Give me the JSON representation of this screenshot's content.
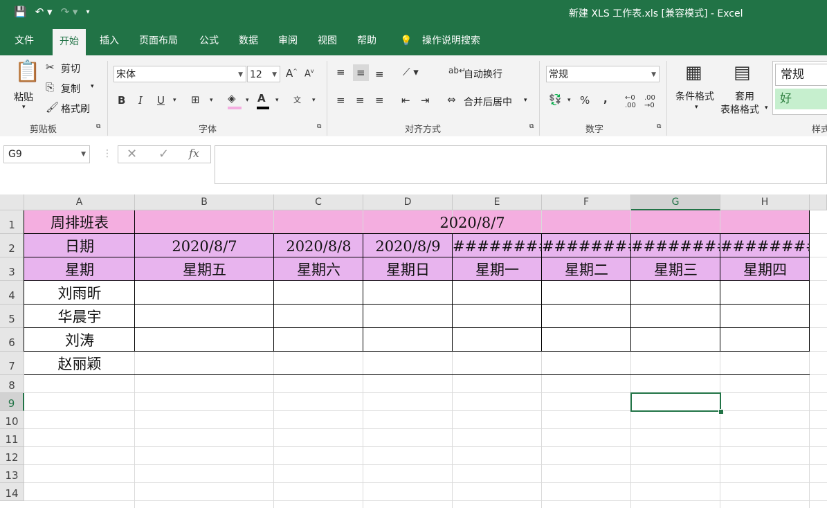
{
  "title": "新建 XLS 工作表.xls  [兼容模式]  -  Excel",
  "tabs": [
    "文件",
    "开始",
    "插入",
    "页面布局",
    "公式",
    "数据",
    "审阅",
    "视图",
    "帮助",
    "操作说明搜索"
  ],
  "clipboard": {
    "paste": "粘贴",
    "cut": "剪切",
    "copy": "复制",
    "format_painter": "格式刷",
    "label": "剪贴板"
  },
  "font": {
    "name": "宋体",
    "size": "12",
    "bold": "B",
    "italic": "I",
    "underline": "U",
    "label": "字体"
  },
  "align": {
    "wrap": "自动换行",
    "merge": "合并后居中",
    "label": "对齐方式"
  },
  "number": {
    "format": "常规",
    "percent": "%",
    "comma": ",",
    "label": "数字"
  },
  "styles": {
    "cond": "条件格式",
    "table1": "套用",
    "table2": "表格格式",
    "normal": "常规",
    "good": "好",
    "label": "样式"
  },
  "formula": {
    "namebox": "G9",
    "fx": "fx",
    "content": ""
  },
  "columns": [
    "A",
    "B",
    "C",
    "D",
    "E",
    "F",
    "G",
    "H"
  ],
  "rows": [
    "1",
    "2",
    "3",
    "4",
    "5",
    "6",
    "7",
    "8",
    "9",
    "10",
    "11",
    "12",
    "13",
    "14"
  ],
  "sheet": {
    "r1": {
      "a": "周排班表",
      "merged": "2020/8/7"
    },
    "r2": [
      "日期",
      "2020/8/7",
      "2020/8/8",
      "2020/8/9",
      "########",
      "########",
      "########",
      "########"
    ],
    "r3": [
      "星期",
      "星期五",
      "星期六",
      "星期日",
      "星期一",
      "星期二",
      "星期三",
      "星期四"
    ],
    "names": [
      "刘雨昕",
      "华晨宇",
      "刘涛",
      "赵丽颖"
    ]
  },
  "colors": {
    "accent": "#217346",
    "r1": "#f4aee0",
    "r23": "#e8b4ee"
  }
}
